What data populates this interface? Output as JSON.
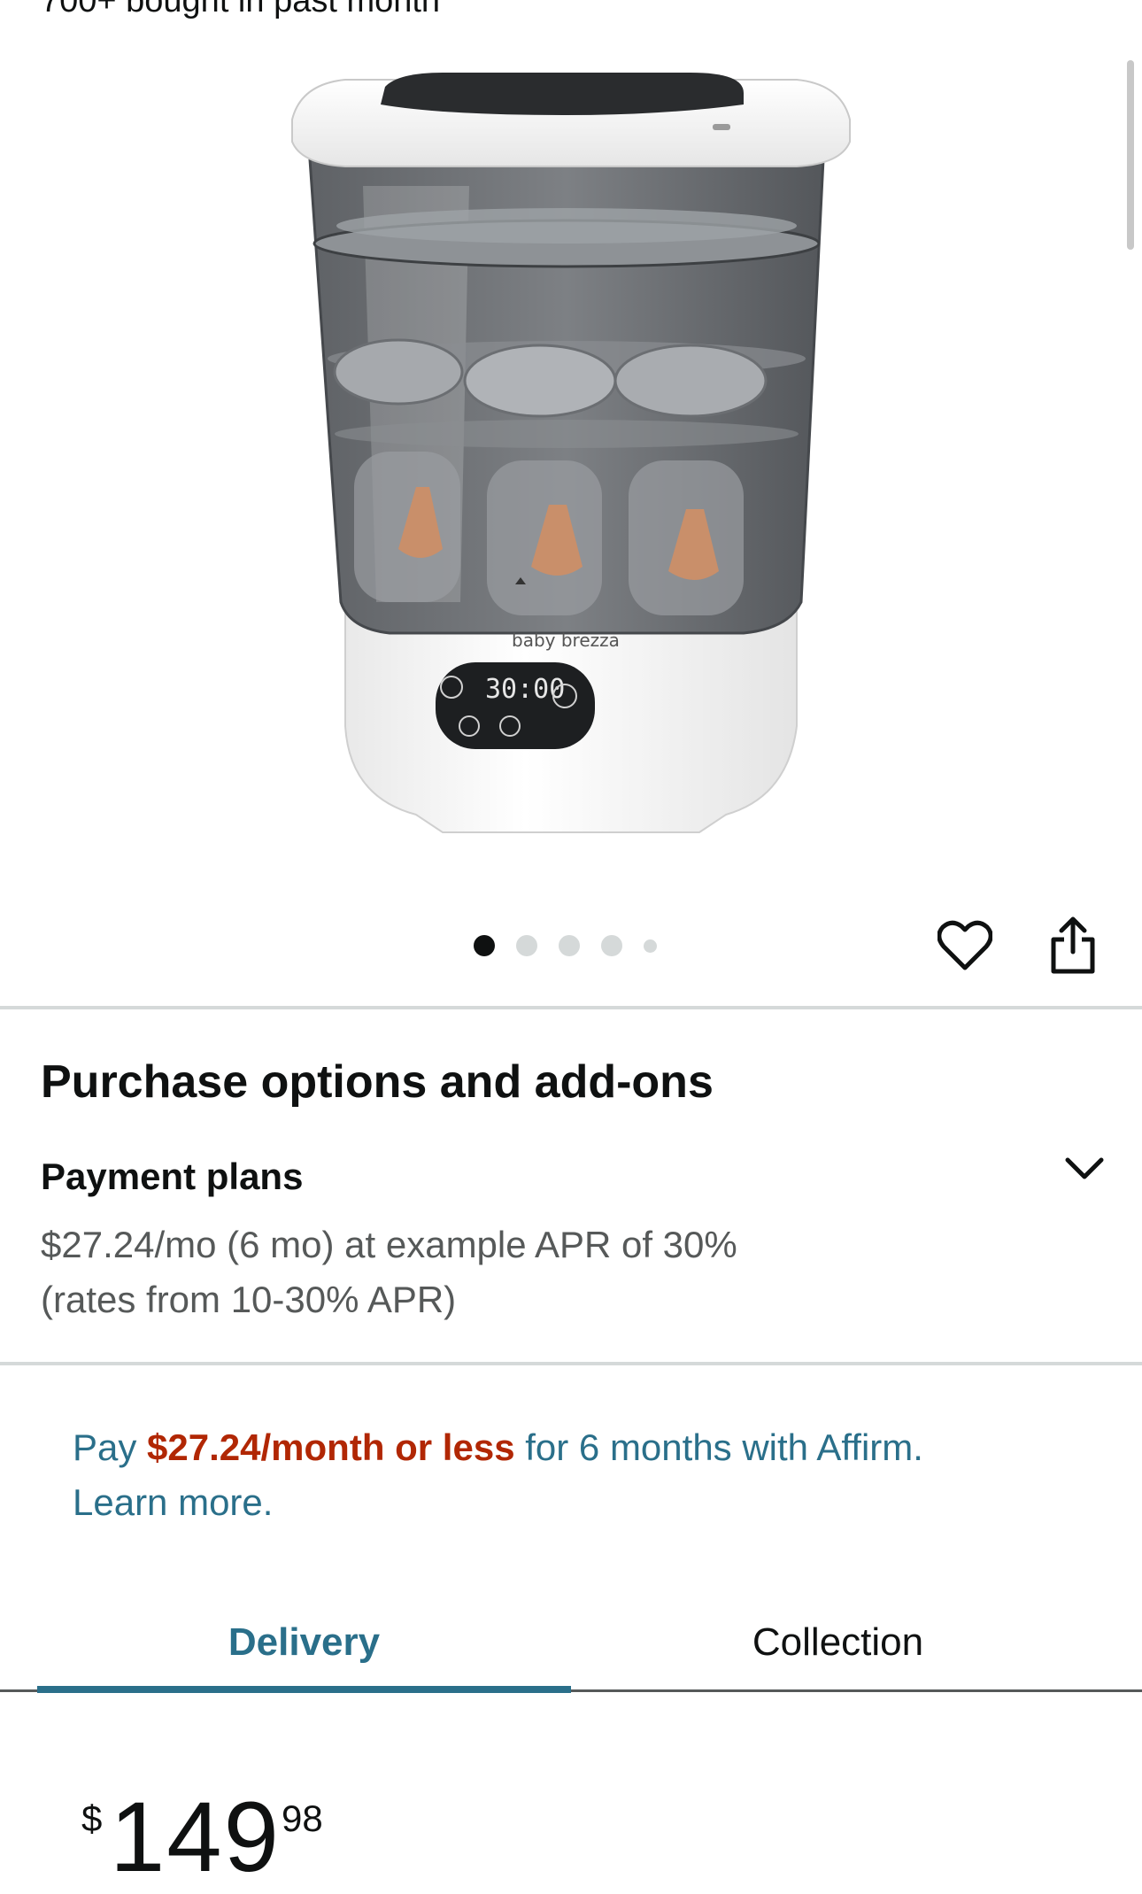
{
  "product": {
    "bought_text": "700+ bought in past month",
    "image_alt": "baby brezza",
    "display_time": "30:00"
  },
  "carousel": {
    "total": 5,
    "active_index": 0
  },
  "icons": {
    "heart": "heart-icon",
    "share": "share-icon",
    "chevron": "chevron-down-icon"
  },
  "purchase": {
    "section_title": "Purchase options and add-ons",
    "payment_header": "Payment plans",
    "payment_line1": "$27.24/mo (6 mo) at example APR of 30%",
    "payment_line2": "(rates from 10-30% APR)"
  },
  "affirm": {
    "prefix": "Pay ",
    "amount": "$27.24/month or less",
    "suffix": " for 6 months with Affirm.",
    "learn_more": "Learn more."
  },
  "tabs": [
    {
      "label": "Delivery",
      "selected": true
    },
    {
      "label": "Collection",
      "selected": false
    }
  ],
  "price": {
    "symbol": "$",
    "whole": "149",
    "fraction": "98"
  },
  "colors": {
    "link_teal": "#2a6f8a",
    "price_red": "#b12704",
    "text": "#0f1111",
    "muted": "#565959"
  }
}
